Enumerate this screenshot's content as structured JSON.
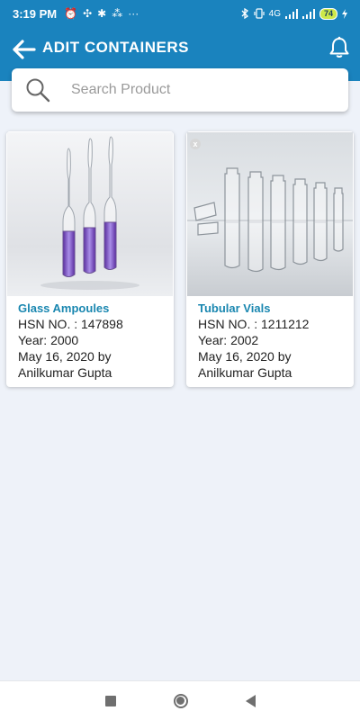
{
  "status_bar": {
    "time": "3:19 PM",
    "icons_left": [
      "⏰",
      "✣",
      "✱",
      "⁂",
      "···"
    ],
    "network": "4G",
    "battery": "74"
  },
  "header": {
    "title": "ADIT CONTAINERS"
  },
  "search": {
    "placeholder": "Search Product"
  },
  "products": [
    {
      "name": "Glass Ampoules",
      "hsn": "HSN NO. :  147898",
      "year": "Year: 2000",
      "date": "May 16, 2020 by",
      "author": "Anilkumar Gupta"
    },
    {
      "name": "Tubular Vials",
      "hsn": "HSN NO. :  1211212",
      "year": "Year: 2002",
      "date": "May 16, 2020 by",
      "author": "Anilkumar Gupta",
      "badge": "x"
    }
  ],
  "colors": {
    "primary": "#1a83be",
    "product_name": "#1a87b0",
    "background": "#eef2f9"
  }
}
